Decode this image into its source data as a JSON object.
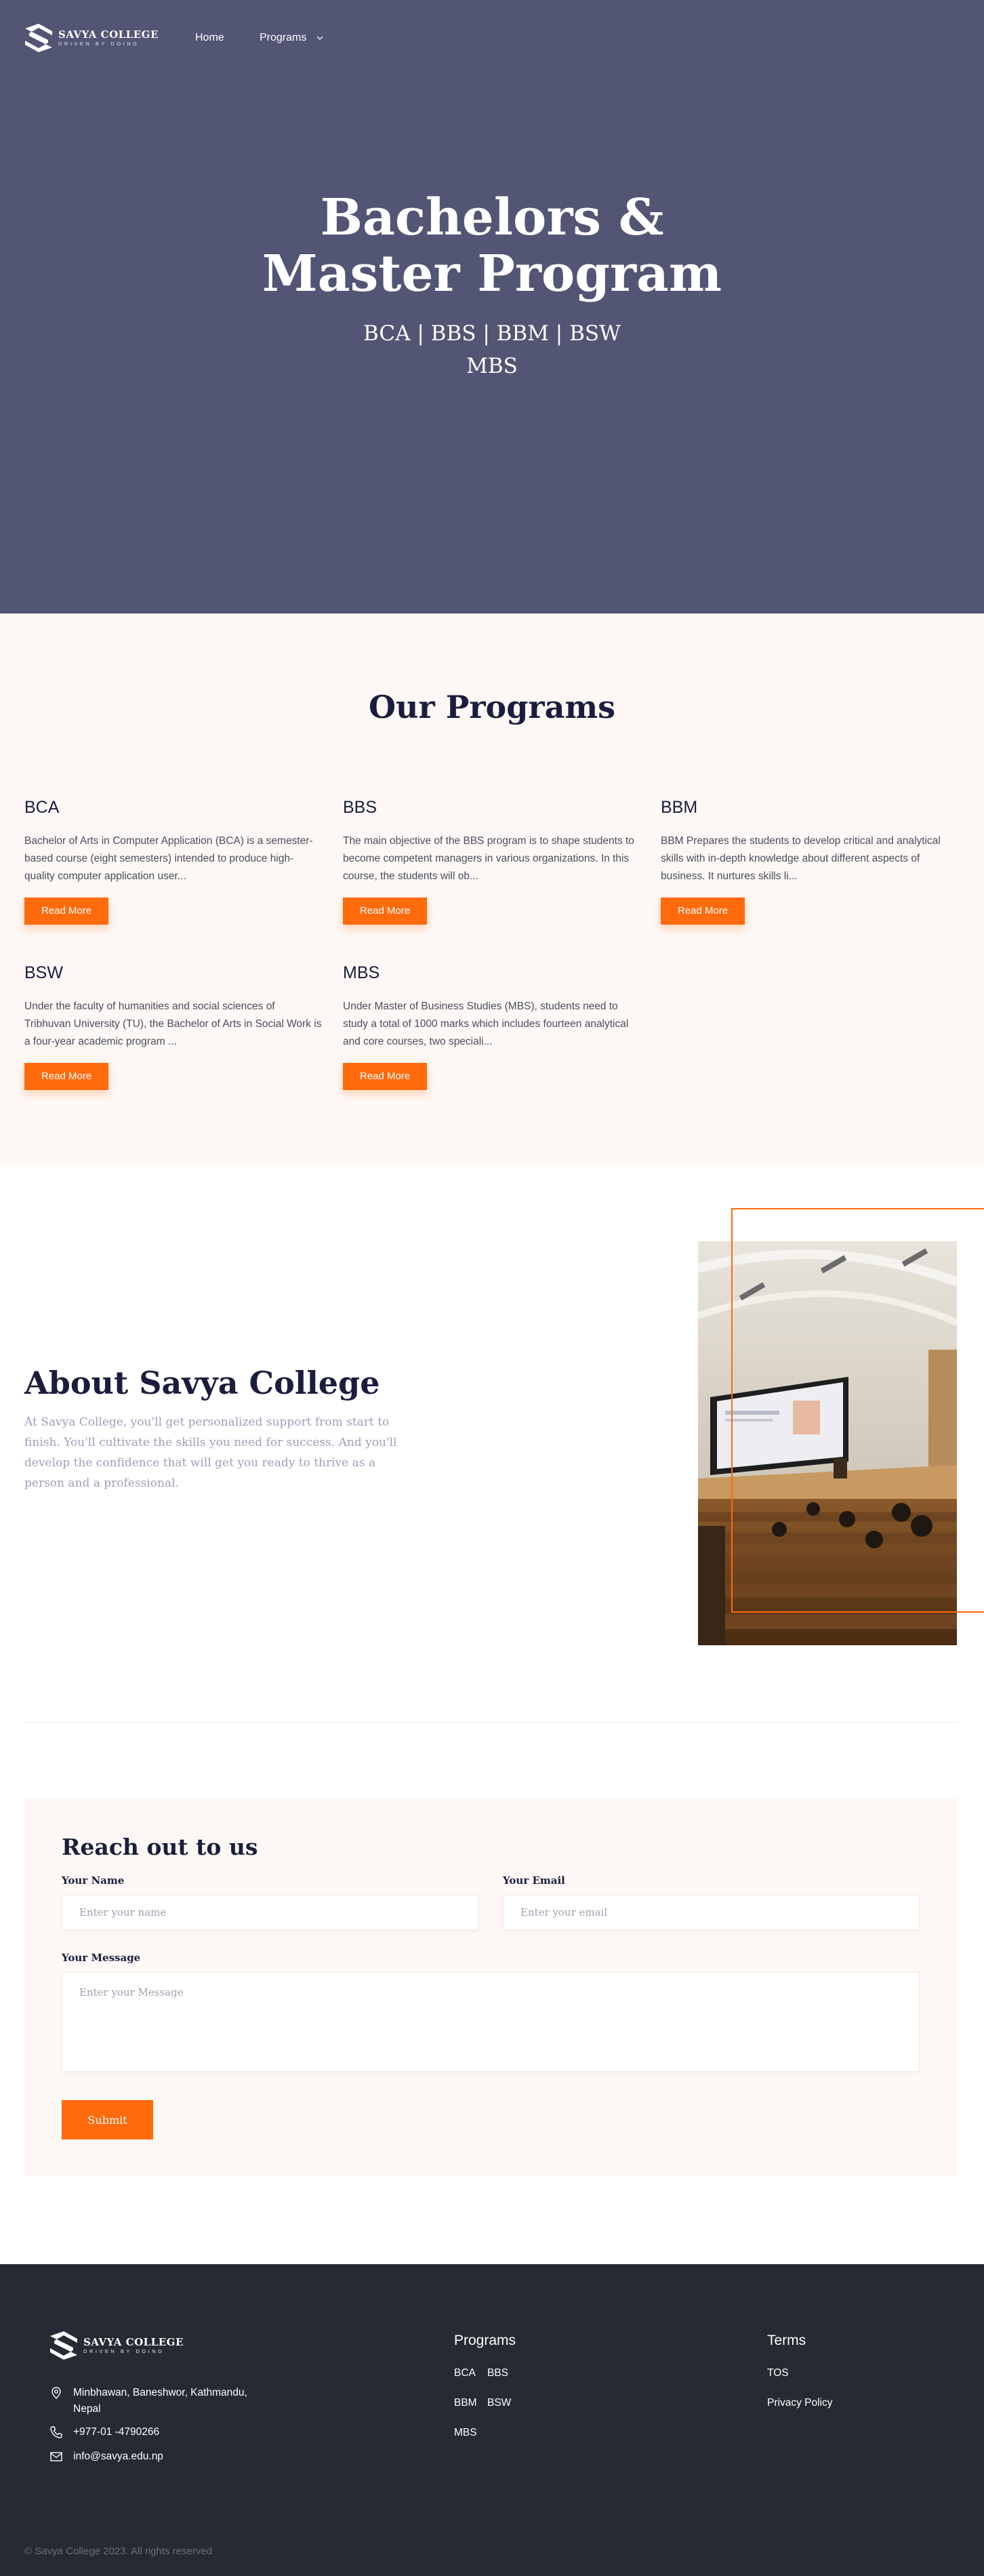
{
  "brand": {
    "name": "SAVYA COLLEGE",
    "tagline": "DRIVEN BY DOING"
  },
  "nav": {
    "items": [
      {
        "label": "Home"
      },
      {
        "label": "Programs"
      }
    ]
  },
  "hero": {
    "title_line1": "Bachelors &",
    "title_line2": "Master Program",
    "subtitle_line1": "BCA | BBS | BBM | BSW",
    "subtitle_line2": "MBS"
  },
  "programs": {
    "title": "Our Programs",
    "button_label": "Read More",
    "items": [
      {
        "name": "BCA",
        "description": "Bachelor of Arts in Computer Application (BCA) is a semester-based course (eight semesters) intended to produce high-quality computer application user..."
      },
      {
        "name": "BBS",
        "description": "The main objective of the BBS program is to shape students to become competent managers in various organizations. In this course, the students will ob..."
      },
      {
        "name": "BBM",
        "description": "BBM Prepares the students to develop critical and analytical skills with in-depth knowledge about different aspects of business. It nurtures skills li..."
      },
      {
        "name": "BSW",
        "description": "Under the faculty of humanities and social sciences of Tribhuvan University (TU), the Bachelor of Arts in Social Work is a four-year academic program ..."
      },
      {
        "name": "MBS",
        "description": "Under Master of Business Studies (MBS), students need to study a total of 1000 marks which includes fourteen analytical and core courses, two speciali..."
      }
    ]
  },
  "about": {
    "title": "About Savya College",
    "description": "At Savya College, you'll get personalized support from start to finish. You'll cultivate the skills you need for success. And you'll develop the confidence that will get you ready to thrive as a person and a professional."
  },
  "contact": {
    "title": "Reach out to us",
    "name_label": "Your Name",
    "name_placeholder": "Enter your name",
    "email_label": "Your Email",
    "email_placeholder": "Enter your email",
    "message_label": "Your Message",
    "message_placeholder": "Enter your Message",
    "submit_label": "Submit"
  },
  "footer": {
    "address": "Minbhawan, Baneshwor, Kathmandu, Nepal",
    "phone": "+977-01 -4790266",
    "email": "info@savya.edu.np",
    "programs_heading": "Programs",
    "programs_links": [
      "BCA",
      "BBS",
      "BBM",
      "BSW",
      "MBS"
    ],
    "terms_heading": "Terms",
    "terms_links": [
      "TOS",
      "Privacy Policy"
    ],
    "copyright": "© Savya College 2023. All rights reserved"
  },
  "colors": {
    "hero_bg": "#525574",
    "accent": "#ff6a0d",
    "section_bg": "#fdf8f5",
    "heading": "#1a1d3d",
    "footer_bg": "#272a33"
  }
}
